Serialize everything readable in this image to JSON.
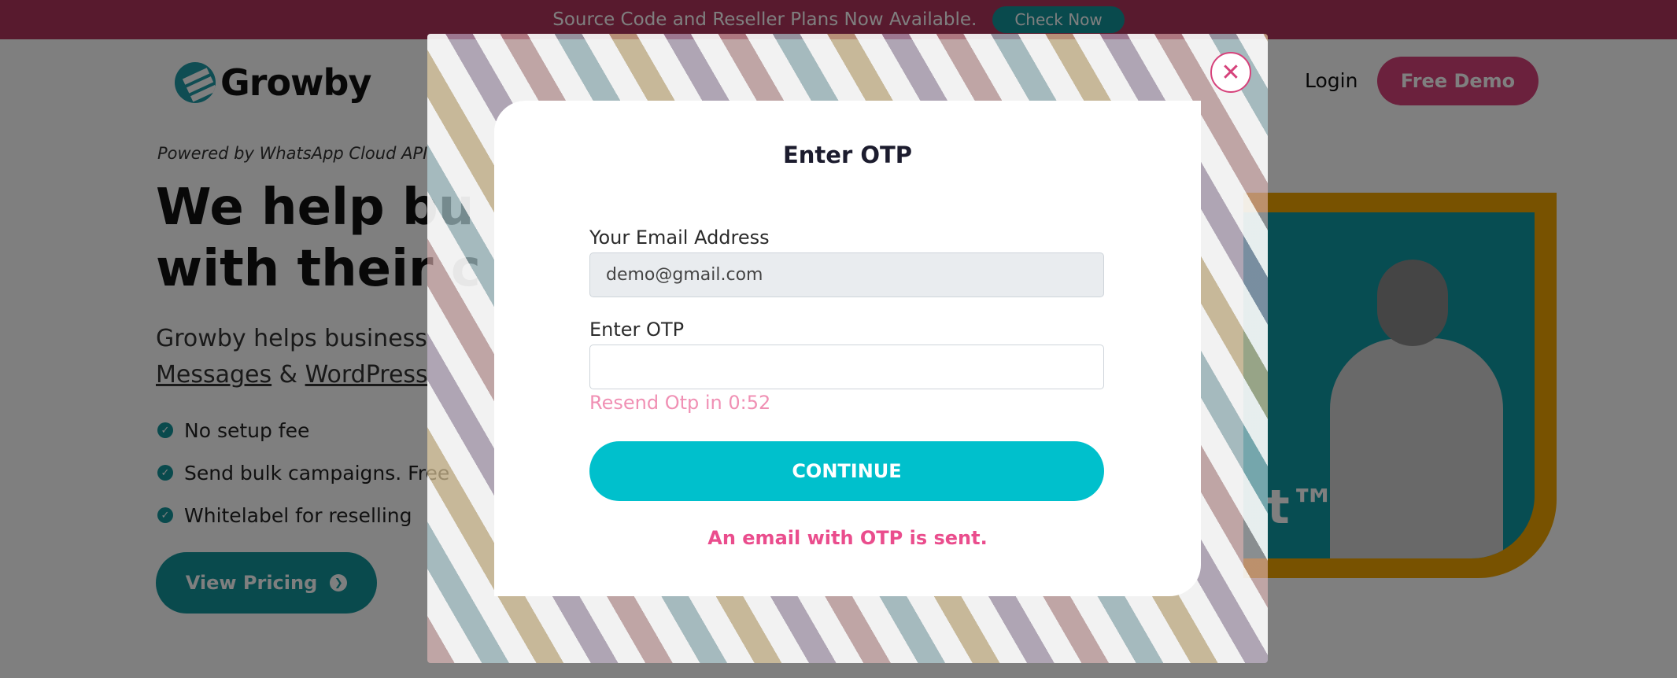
{
  "topbar": {
    "message": "Source Code and Reseller Plans Now Available.",
    "cta": "Check Now"
  },
  "header": {
    "brand": "Growby",
    "login": "Login",
    "free_demo": "Free Demo"
  },
  "hero": {
    "powered_by": "Powered by WhatsApp Cloud API",
    "title_line1": "We help bu",
    "title_line2": "with their c",
    "subtitle_line1": "Growby helps business",
    "subtitle_link1": "Messages",
    "subtitle_amp": " & ",
    "subtitle_link2": "WordPress",
    "features": [
      "No setup fee",
      "Send bulk campaigns. Free",
      "Whitelabel for reselling"
    ],
    "view_pricing": "View Pricing",
    "art_text": "t™"
  },
  "modal": {
    "title": "Enter OTP",
    "email_label": "Your Email Address",
    "email_value": "demo@gmail.com",
    "otp_label": "Enter OTP",
    "otp_value": "",
    "resend": "Resend Otp in 0:52",
    "continue": "CONTINUE",
    "notice": "An email with OTP is sent.",
    "close_icon": "close-icon"
  },
  "colors": {
    "topbar": "#b0345d",
    "brand_teal": "#13949b",
    "pink": "#d6427b",
    "continue": "#00c0cc",
    "notice": "#ea4d8d",
    "resend": "#f090b4"
  }
}
